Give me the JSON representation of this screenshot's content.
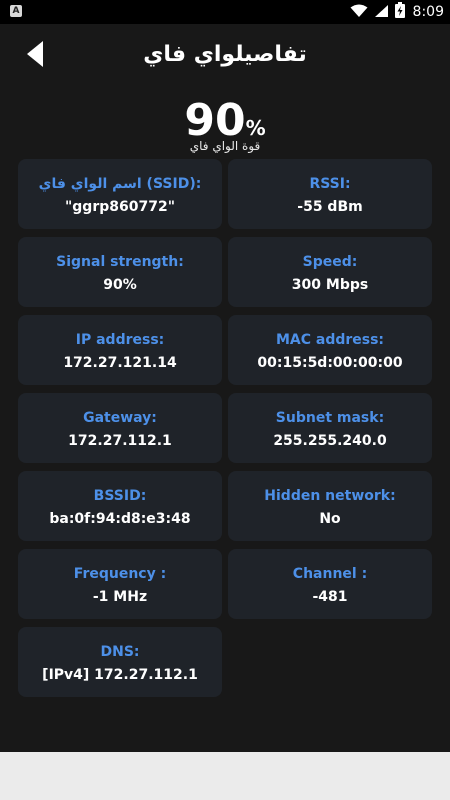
{
  "status_bar": {
    "notification_icon": "A",
    "time": "8:09"
  },
  "header": {
    "title": "تفاصيلواي فاي",
    "back_icon": "chevron-left-icon"
  },
  "strength": {
    "value": "90",
    "unit": "%",
    "label": "قوة الواي فاي"
  },
  "cards": [
    {
      "label": "اسم الواي فاي (SSID):",
      "value": "\"ggrp860772\""
    },
    {
      "label": "RSSI:",
      "value": "-55 dBm"
    },
    {
      "label": "Signal strength:",
      "value": "90%"
    },
    {
      "label": "Speed:",
      "value": "300 Mbps"
    },
    {
      "label": "IP address:",
      "value": "172.27.121.14"
    },
    {
      "label": "MAC address:",
      "value": "00:15:5d:00:00:00"
    },
    {
      "label": "Gateway:",
      "value": "172.27.112.1"
    },
    {
      "label": "Subnet mask:",
      "value": "255.255.240.0"
    },
    {
      "label": "BSSID:",
      "value": "ba:0f:94:d8:e3:48"
    },
    {
      "label": "Hidden network:",
      "value": "No"
    },
    {
      "label": "Frequency :",
      "value": "-1 MHz"
    },
    {
      "label": "Channel :",
      "value": "-481"
    },
    {
      "label": "DNS:",
      "value": "[IPv4] 172.27.112.1"
    }
  ],
  "colors": {
    "background": "#181818",
    "card": "#1f2329",
    "label_accent": "#4d90e8"
  }
}
